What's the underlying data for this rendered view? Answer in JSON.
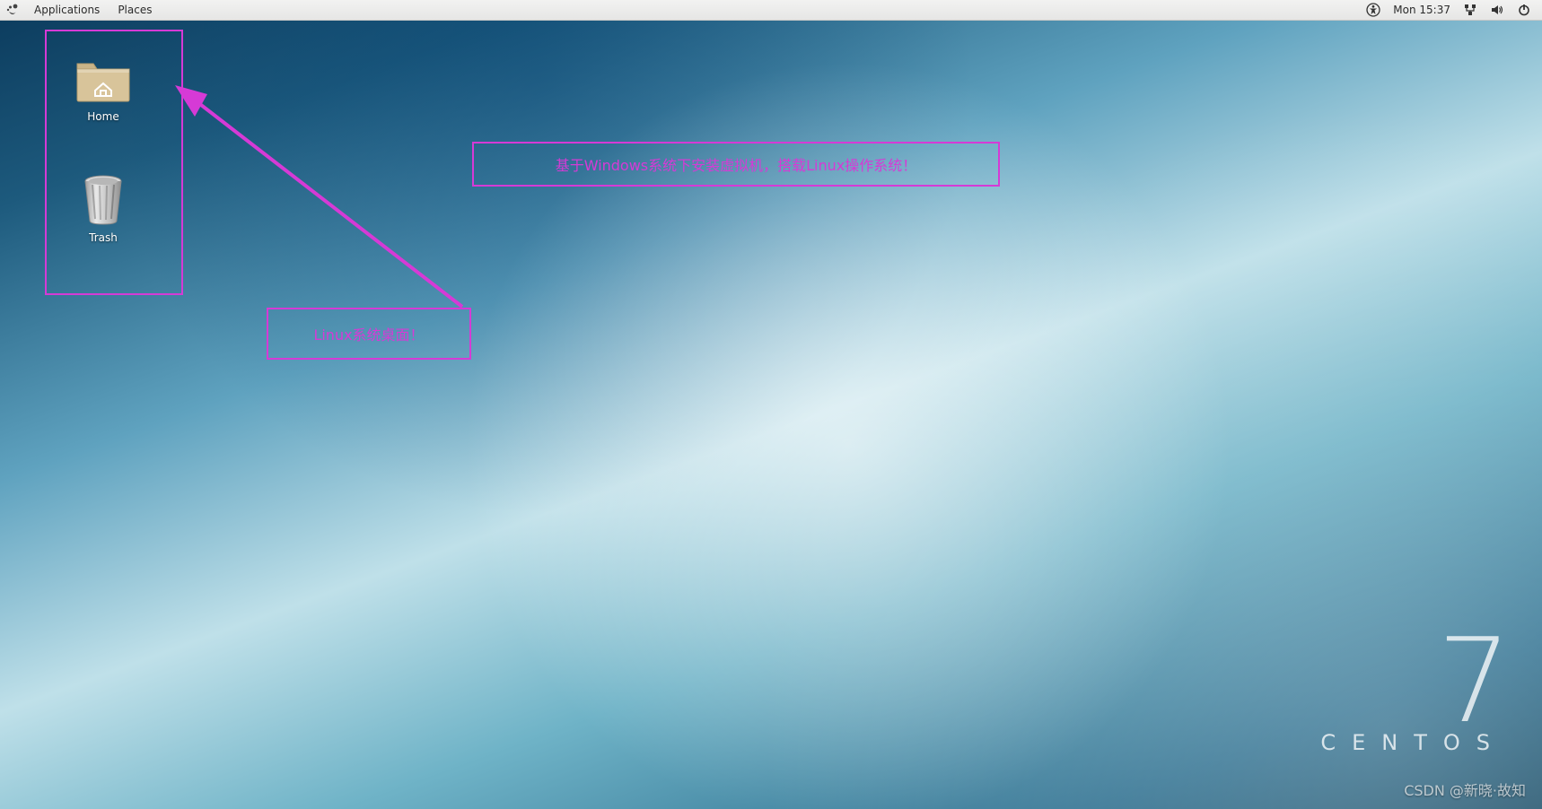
{
  "panel": {
    "menus": [
      "Applications",
      "Places"
    ],
    "clock": "Mon 15:37",
    "tray_icons": [
      "accessibility-icon",
      "network-icon",
      "volume-icon",
      "power-icon"
    ]
  },
  "desktop_icons": [
    {
      "name": "home",
      "label": "Home"
    },
    {
      "name": "trash",
      "label": "Trash"
    }
  ],
  "annotations": {
    "selection_label": "Linux系统桌面！",
    "top_label": "基于Windows系统下安装虚拟机，搭载Linux操作系统！"
  },
  "branding": {
    "number": "7",
    "word": "CENTOS"
  },
  "watermark": "CSDN @新晓·故知",
  "colors": {
    "annotation": "#d63ad6",
    "panel_bg": "#e9e9e8"
  }
}
